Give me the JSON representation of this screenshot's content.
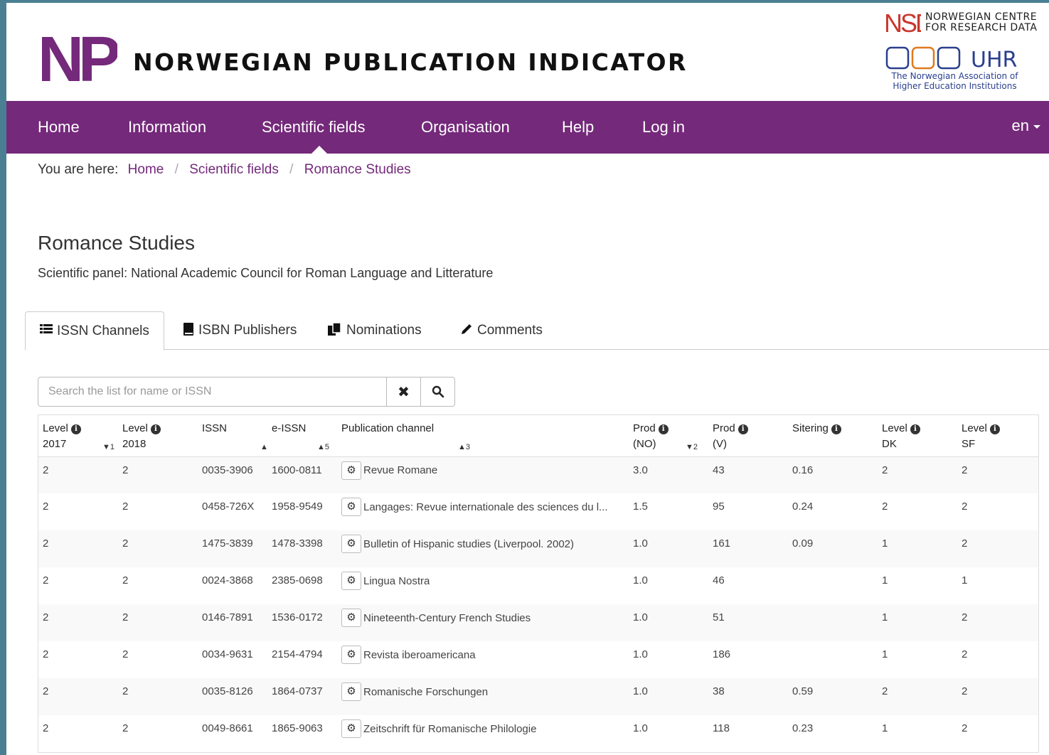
{
  "header": {
    "logo_text": "NPi",
    "title": "NORWEGIAN PUBLICATION INDICATOR",
    "nsd_line1": "NORWEGIAN CENTRE",
    "nsd_line2": "FOR RESEARCH DATA",
    "uhr_text": "UHR",
    "uhr_caption1": "The Norwegian Association of",
    "uhr_caption2": "Higher Education Institutions"
  },
  "nav": {
    "items": [
      "Home",
      "Information",
      "Scientific fields",
      "Organisation",
      "Help",
      "Log in"
    ],
    "active": "Scientific fields",
    "language": "en"
  },
  "breadcrumb": {
    "prefix": "You are here:",
    "items": [
      "Home",
      "Scientific fields",
      "Romance Studies"
    ]
  },
  "page": {
    "title": "Romance Studies",
    "panel": "Scientific panel: National Academic Council for Roman Language and Litterature"
  },
  "tabs": [
    {
      "label": "ISSN Channels",
      "icon": "list-icon",
      "active": true
    },
    {
      "label": "ISBN Publishers",
      "icon": "book-icon",
      "active": false
    },
    {
      "label": "Nominations",
      "icon": "files-icon",
      "active": false
    },
    {
      "label": "Comments",
      "icon": "pencil-icon",
      "active": false
    }
  ],
  "search": {
    "placeholder": "Search the list for name or ISSN",
    "value": ""
  },
  "table": {
    "headers": [
      {
        "line1": "Level",
        "line2": "2017",
        "info": true,
        "sort": "▼1"
      },
      {
        "line1": "Level",
        "line2": "2018",
        "info": true,
        "sort": ""
      },
      {
        "line1": "ISSN",
        "line2": "",
        "info": false,
        "sort": "▲4"
      },
      {
        "line1": "e-ISSN",
        "line2": "",
        "info": false,
        "sort": "▲5"
      },
      {
        "line1": "Publication channel",
        "line2": "",
        "info": false,
        "sort": "▲3"
      },
      {
        "line1": "Prod",
        "line2": "(NO)",
        "info": true,
        "sort": "▼2"
      },
      {
        "line1": "Prod",
        "line2": "(V)",
        "info": true,
        "sort": ""
      },
      {
        "line1": "Sitering",
        "line2": "",
        "info": true,
        "sort": ""
      },
      {
        "line1": "Level",
        "line2": "DK",
        "info": true,
        "sort": ""
      },
      {
        "line1": "Level",
        "line2": "SF",
        "info": true,
        "sort": ""
      }
    ],
    "rows": [
      {
        "level2017": "2",
        "level2018": "2",
        "issn": "0035-3906",
        "eissn": "1600-0811",
        "channel": "Revue Romane",
        "prod_no": "3.0",
        "prod_v": "43",
        "sitering": "0.16",
        "level_dk": "2",
        "level_sf": "2"
      },
      {
        "level2017": "2",
        "level2018": "2",
        "issn": "0458-726X",
        "eissn": "1958-9549",
        "channel": "Langages: Revue internationale des sciences du l...",
        "prod_no": "1.5",
        "prod_v": "95",
        "sitering": "0.24",
        "level_dk": "2",
        "level_sf": "2"
      },
      {
        "level2017": "2",
        "level2018": "2",
        "issn": "1475-3839",
        "eissn": "1478-3398",
        "channel": "Bulletin of Hispanic studies (Liverpool. 2002)",
        "prod_no": "1.0",
        "prod_v": "161",
        "sitering": "0.09",
        "level_dk": "1",
        "level_sf": "2"
      },
      {
        "level2017": "2",
        "level2018": "2",
        "issn": "0024-3868",
        "eissn": "2385-0698",
        "channel": "Lingua Nostra",
        "prod_no": "1.0",
        "prod_v": "46",
        "sitering": "",
        "level_dk": "1",
        "level_sf": "1"
      },
      {
        "level2017": "2",
        "level2018": "2",
        "issn": "0146-7891",
        "eissn": "1536-0172",
        "channel": "Nineteenth-Century French Studies",
        "prod_no": "1.0",
        "prod_v": "51",
        "sitering": "",
        "level_dk": "1",
        "level_sf": "2"
      },
      {
        "level2017": "2",
        "level2018": "2",
        "issn": "0034-9631",
        "eissn": "2154-4794",
        "channel": "Revista iberoamericana",
        "prod_no": "1.0",
        "prod_v": "186",
        "sitering": "",
        "level_dk": "1",
        "level_sf": "2"
      },
      {
        "level2017": "2",
        "level2018": "2",
        "issn": "0035-8126",
        "eissn": "1864-0737",
        "channel": "Romanische Forschungen",
        "prod_no": "1.0",
        "prod_v": "38",
        "sitering": "0.59",
        "level_dk": "2",
        "level_sf": "2"
      },
      {
        "level2017": "2",
        "level2018": "2",
        "issn": "0049-8661",
        "eissn": "1865-9063",
        "channel": "Zeitschrift für Romanische Philologie",
        "prod_no": "1.0",
        "prod_v": "118",
        "sitering": "0.23",
        "level_dk": "1",
        "level_sf": "2"
      }
    ]
  },
  "colors": {
    "brand_purple": "#74297a",
    "nsd_red": "#c8372d",
    "uhr_blue": "#2a3f8e",
    "uhr_orange": "#e07a1f"
  }
}
